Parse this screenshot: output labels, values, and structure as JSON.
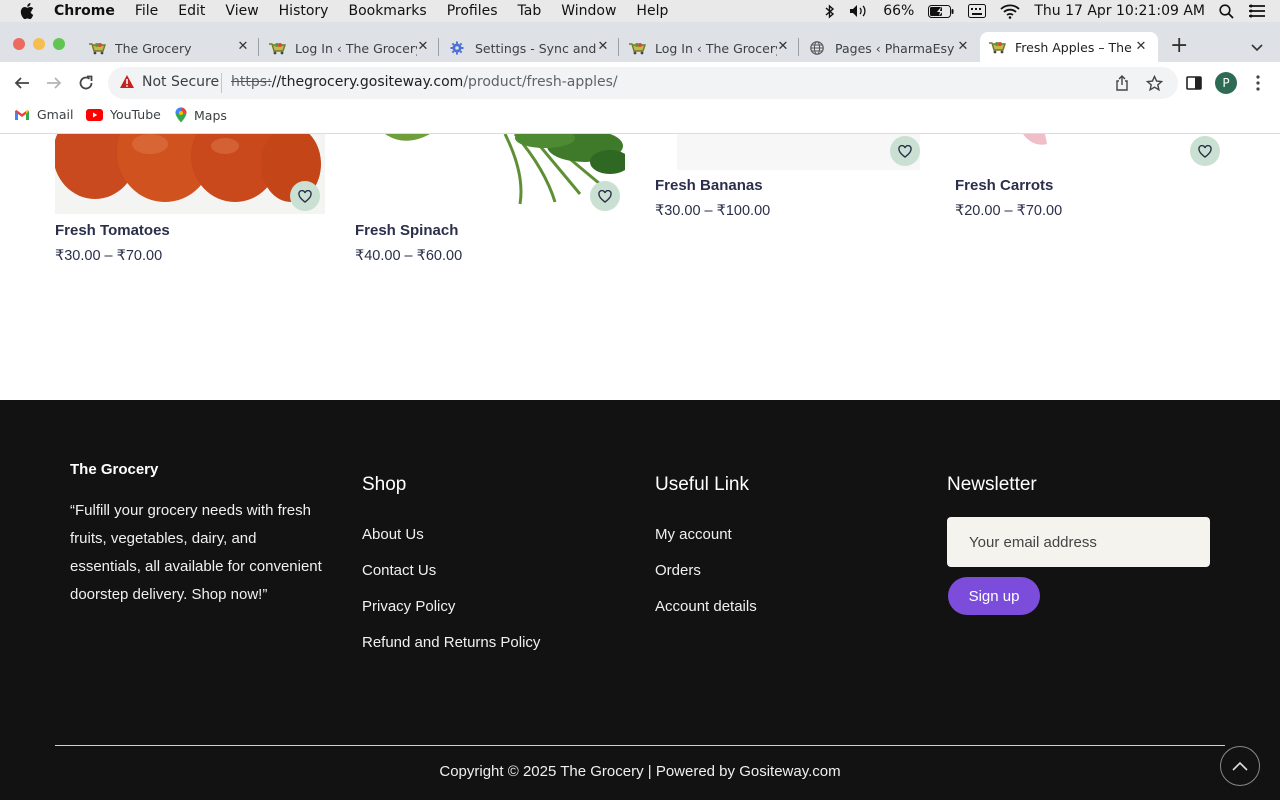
{
  "menubar": {
    "app": "Chrome",
    "items": [
      "File",
      "Edit",
      "View",
      "History",
      "Bookmarks",
      "Profiles",
      "Tab",
      "Window",
      "Help"
    ],
    "battery": "66%",
    "datetime": "Thu 17 Apr  10:21:09 AM"
  },
  "tabs": [
    {
      "title": "The Grocery",
      "icon": "grocery-cart-icon"
    },
    {
      "title": "Log In ‹ The Grocery",
      "icon": "grocery-cart-icon"
    },
    {
      "title": "Settings - Sync and",
      "icon": "gear-icon"
    },
    {
      "title": "Log In ‹ The Grocery",
      "icon": "grocery-cart-icon"
    },
    {
      "title": "Pages ‹ PharmaEsy",
      "icon": "globe-icon"
    },
    {
      "title": "Fresh Apples – The G",
      "icon": "grocery-cart-icon",
      "active": true
    }
  ],
  "toolbar": {
    "security": "Not Secure",
    "url_scheme": "https:",
    "url_host": "//thegrocery.gositeway.com",
    "url_path": "/product/fresh-apples/",
    "avatar_letter": "P"
  },
  "bookmarks": [
    {
      "label": "Gmail",
      "icon": "gmail-icon"
    },
    {
      "label": "YouTube",
      "icon": "youtube-icon"
    },
    {
      "label": "Maps",
      "icon": "maps-icon"
    }
  ],
  "products": [
    {
      "name": "Fresh Tomatoes",
      "price": "₹30.00 – ₹70.00"
    },
    {
      "name": "Fresh Spinach",
      "price": "₹40.00 – ₹60.00"
    },
    {
      "name": "Fresh Bananas",
      "price": "₹30.00 – ₹100.00"
    },
    {
      "name": "Fresh Carrots",
      "price": "₹20.00 – ₹70.00"
    }
  ],
  "footer": {
    "brand": "The Grocery",
    "quote": "“Fulfill your grocery needs with fresh fruits, vegetables, dairy, and essentials, all available for convenient doorstep delivery. Shop now!”",
    "shop": {
      "heading": "Shop",
      "links": [
        "About Us",
        "Contact Us",
        "Privacy Policy",
        "Refund and Returns Policy"
      ]
    },
    "useful": {
      "heading": "Useful Link",
      "links": [
        "My account",
        "Orders",
        "Account details"
      ]
    },
    "newsletter": {
      "heading": "Newsletter",
      "placeholder": "Your email address",
      "button": "Sign up"
    },
    "copyright": "Copyright © 2025 The Grocery | Powered by Gositeway.com"
  },
  "colors": {
    "footer_bg": "#121212",
    "accent": "#7c4ddb",
    "wishlist_bg": "#c9e0d2",
    "product_text": "#2b2f4b"
  }
}
